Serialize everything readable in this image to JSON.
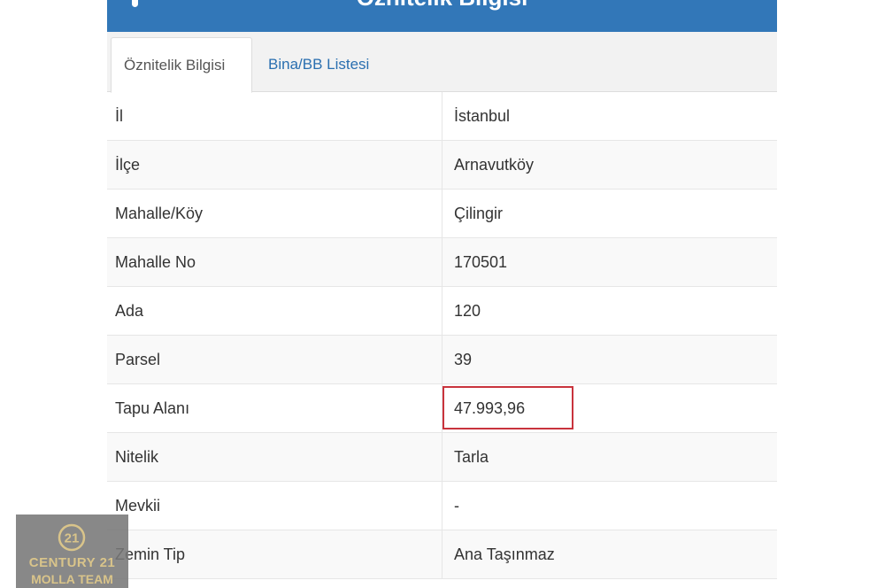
{
  "header": {
    "title": "Öznitelik Bilgisi"
  },
  "tabs": [
    {
      "label": "Öznitelik Bilgisi",
      "active": true
    },
    {
      "label": "Bina/BB Listesi",
      "active": false
    }
  ],
  "attributes": [
    {
      "label": "İl",
      "value": "İstanbul"
    },
    {
      "label": "İlçe",
      "value": "Arnavutköy"
    },
    {
      "label": "Mahalle/Köy",
      "value": "Çilingir"
    },
    {
      "label": "Mahalle No",
      "value": "170501"
    },
    {
      "label": "Ada",
      "value": "120"
    },
    {
      "label": "Parsel",
      "value": "39"
    },
    {
      "label": "Tapu Alanı",
      "value": "47.993,96",
      "highlighted": true
    },
    {
      "label": "Nitelik",
      "value": "Tarla"
    },
    {
      "label": "Mevkii",
      "value": "-"
    },
    {
      "label": "Zemin Tip",
      "value": "Ana Taşınmaz"
    }
  ],
  "watermark": {
    "brand": "CENTURY 21",
    "team": "MOLLA TEAM",
    "icon": "century21-seal-icon"
  },
  "colors": {
    "header_blue": "#3277b8",
    "tab_link_blue": "#2a6fb0",
    "highlight_red": "#c9343d",
    "watermark_gold": "#d9c48a"
  }
}
